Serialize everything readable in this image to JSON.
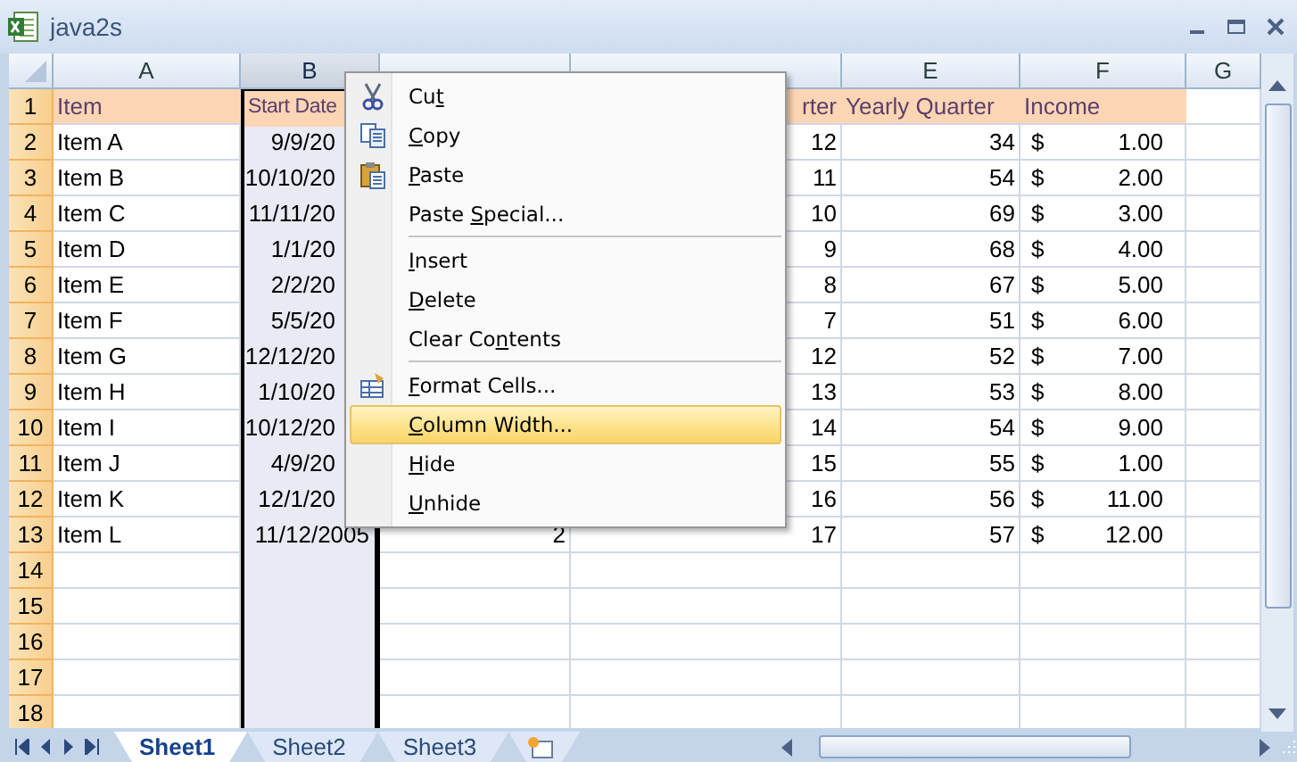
{
  "window": {
    "title": "java2s"
  },
  "columns": [
    {
      "letter": "A",
      "selected": false
    },
    {
      "letter": "B",
      "selected": true
    },
    {
      "selected": false
    },
    {
      "selected": false
    },
    {
      "letter": "E",
      "selected": false
    },
    {
      "letter": "F",
      "selected": false
    },
    {
      "letter": "G",
      "selected": false
    }
  ],
  "rows": [
    {
      "number": "1",
      "kind": "header",
      "cells": {
        "A": "Item",
        "B": "Start Date",
        "D": "rter",
        "E": "Yearly Quarter",
        "F": "Income"
      }
    },
    {
      "number": "2",
      "kind": "data",
      "cells": {
        "A": "Item A",
        "B": "9/9/20",
        "D": "12",
        "E": "34",
        "F": [
          "$",
          "1.00"
        ]
      }
    },
    {
      "number": "3",
      "kind": "data",
      "cells": {
        "A": "Item B",
        "B": "10/10/20",
        "D": "11",
        "E": "54",
        "F": [
          "$",
          "2.00"
        ]
      }
    },
    {
      "number": "4",
      "kind": "data",
      "cells": {
        "A": "Item C",
        "B": "11/11/20",
        "D": "10",
        "E": "69",
        "F": [
          "$",
          "3.00"
        ]
      }
    },
    {
      "number": "5",
      "kind": "data",
      "cells": {
        "A": "Item D",
        "B": "1/1/20",
        "D": "9",
        "E": "68",
        "F": [
          "$",
          "4.00"
        ]
      }
    },
    {
      "number": "6",
      "kind": "data",
      "cells": {
        "A": "Item E",
        "B": "2/2/20",
        "D": "8",
        "E": "67",
        "F": [
          "$",
          "5.00"
        ]
      }
    },
    {
      "number": "7",
      "kind": "data",
      "cells": {
        "A": "Item F",
        "B": "5/5/20",
        "D": "7",
        "E": "51",
        "F": [
          "$",
          "6.00"
        ]
      }
    },
    {
      "number": "8",
      "kind": "data",
      "cells": {
        "A": "Item G",
        "B": "12/12/20",
        "D": "12",
        "E": "52",
        "F": [
          "$",
          "7.00"
        ]
      }
    },
    {
      "number": "9",
      "kind": "data",
      "cells": {
        "A": "Item H",
        "B": "1/10/20",
        "D": "13",
        "E": "53",
        "F": [
          "$",
          "8.00"
        ]
      }
    },
    {
      "number": "10",
      "kind": "data",
      "cells": {
        "A": "Item I",
        "B": "10/12/20",
        "D": "14",
        "E": "54",
        "F": [
          "$",
          "9.00"
        ]
      }
    },
    {
      "number": "11",
      "kind": "data",
      "cells": {
        "A": "Item J",
        "B": "4/9/20",
        "D": "15",
        "E": "55",
        "F": [
          "$",
          "1.00"
        ]
      }
    },
    {
      "number": "12",
      "kind": "data",
      "cells": {
        "A": "Item K",
        "B": "12/1/20",
        "D": "16",
        "E": "56",
        "F": [
          "$",
          "11.00"
        ]
      }
    },
    {
      "number": "13",
      "kind": "data",
      "cells": {
        "A": "Item L",
        "B": "11/12/2005",
        "C": "2",
        "D": "17",
        "E": "57",
        "F": [
          "$",
          "12.00"
        ]
      }
    },
    {
      "number": "14",
      "kind": "data",
      "cells": {}
    },
    {
      "number": "15",
      "kind": "data",
      "cells": {}
    },
    {
      "number": "16",
      "kind": "data",
      "cells": {}
    },
    {
      "number": "17",
      "kind": "data",
      "cells": {}
    },
    {
      "number": "18",
      "kind": "data",
      "cells": {}
    }
  ],
  "context_menu": {
    "items": [
      {
        "kind": "cut",
        "before": "Cu",
        "key": "t",
        "selected": false,
        "separator_before": false
      },
      {
        "kind": "copy",
        "key": "C",
        "after": "opy",
        "selected": false,
        "separator_before": false
      },
      {
        "kind": "paste",
        "key": "P",
        "after": "aste",
        "selected": false,
        "separator_before": false
      },
      {
        "kind": "plain",
        "before": "Paste ",
        "key": "S",
        "after": "pecial...",
        "selected": false,
        "separator_before": false
      },
      {
        "kind": "plain",
        "key": "I",
        "after": "nsert",
        "selected": false,
        "separator_before": true
      },
      {
        "kind": "plain",
        "key": "D",
        "after": "elete",
        "selected": false,
        "separator_before": false
      },
      {
        "kind": "plain",
        "before": "Clear Co",
        "key": "n",
        "after": "tents",
        "selected": false,
        "separator_before": false
      },
      {
        "kind": "format",
        "key": "F",
        "after": "ormat Cells...",
        "selected": false,
        "separator_before": true
      },
      {
        "kind": "plain",
        "key": "C",
        "after": "olumn Width...",
        "selected": true,
        "separator_before": false
      },
      {
        "kind": "plain",
        "key": "H",
        "after": "ide",
        "selected": false,
        "separator_before": false
      },
      {
        "kind": "plain",
        "key": "U",
        "after": "nhide",
        "selected": false,
        "separator_before": false
      }
    ]
  },
  "sheet_tabs": [
    {
      "label": "Sheet1",
      "selected": true
    },
    {
      "label": "Sheet2",
      "selected": false
    },
    {
      "label": "Sheet3",
      "selected": false
    }
  ]
}
